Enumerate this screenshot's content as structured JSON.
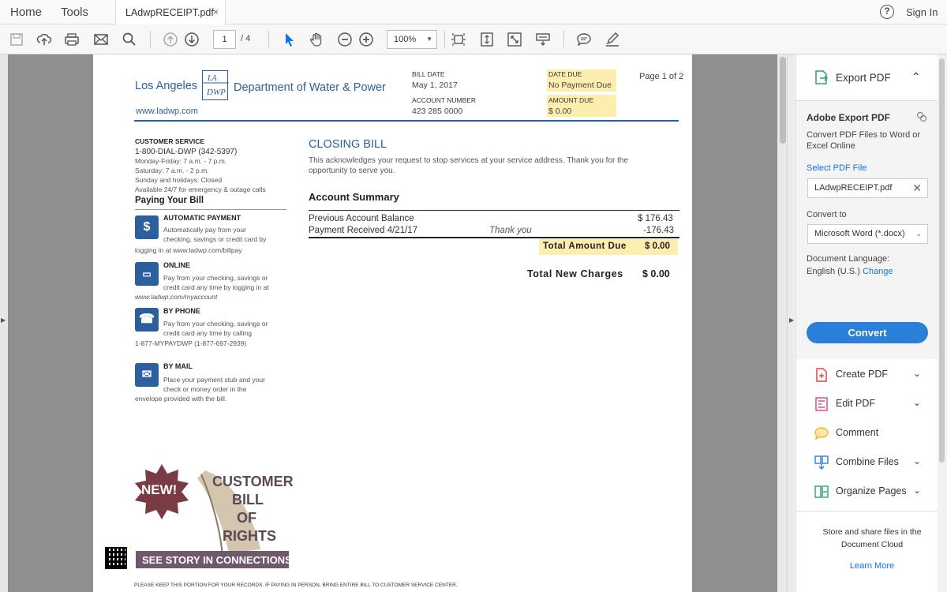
{
  "menu": {
    "home": "Home",
    "tools": "Tools"
  },
  "tab": {
    "title": "LAdwpRECEIPT.pdf",
    "close": "×"
  },
  "header": {
    "help": "?",
    "sign_in": "Sign In"
  },
  "toolbar": {
    "icons": [
      "save-icon",
      "upload-icon",
      "print-icon",
      "email-icon",
      "search-icon",
      "page-up-icon",
      "page-down-icon",
      "select-arrow-icon",
      "hand-tool-icon",
      "zoom-out-icon",
      "zoom-in-icon",
      "fit-page-icon",
      "scroll-mode-icon",
      "full-screen-icon",
      "read-mode-icon",
      "comment-icon",
      "sign-icon"
    ],
    "page_current": "1",
    "page_total": "/ 4",
    "zoom": "100%"
  },
  "bill": {
    "org_left": "Los Angeles",
    "org_right": "Department of Water & Power",
    "logo_text": "LA DWP",
    "website": "www.ladwp.com",
    "bill_date_label": "BILL DATE",
    "bill_date": "May 1, 2017",
    "account_number_label": "ACCOUNT NUMBER",
    "account_number": "423 285 0000",
    "date_due_label": "DATE DUE",
    "date_due": "No Payment Due",
    "amount_due_label": "AMOUNT DUE",
    "amount_due": "$ 0.00",
    "page_of": "Page 1 of 2",
    "customer_service": {
      "title": "CUSTOMER SERVICE",
      "phone": "1-800-DIAL-DWP (342-5397)",
      "hours1": "Monday-Friday: 7 a.m. - 7 p.m.",
      "hours2": "Saturday: 7 a.m. - 2 p.m.",
      "hours3": "Sunday and holidays: Closed",
      "hours4": "Available 24/7 for emergency & outage calls"
    },
    "paying_title": "Paying Your Bill",
    "payment_methods": [
      {
        "title": "AUTOMATIC PAYMENT",
        "line1": "Automatically pay from your",
        "line2": "checking, savings or credit card by",
        "line3": "logging in at www.ladwp.com/billpay"
      },
      {
        "title": "ONLINE",
        "line1": "Pay from your checking, savings or",
        "line2": "credit card any time by logging in at",
        "line3": "www.ladwp.com/myaccount"
      },
      {
        "title": "BY PHONE",
        "line1": "Pay from your checking, savings or",
        "line2": "credit card any time by calling",
        "line3": "1-877-MYPAYDWP (1-877-697-2939)"
      },
      {
        "title": "BY MAIL",
        "line1": "Place your payment stub and your",
        "line2": "check or money order in the",
        "line3": "envelope provided with the bill."
      }
    ],
    "closing_title": "CLOSING BILL",
    "closing_text1": "This acknowledges your request to stop services at your service address. Thank you for the",
    "closing_text2": "opportunity to serve you.",
    "summary_title": "Account Summary",
    "prev_balance_label": "Previous Account Balance",
    "prev_balance": "$ 176.43",
    "payment_label": "Payment Received 4/21/17",
    "payment_note": "Thank you",
    "payment_amount": "-176.43",
    "total_due_label": "Total Amount Due",
    "total_due": "$ 0.00",
    "total_new_label": "Total New Charges",
    "total_new": "$ 0.00",
    "badge_new": "NEW!",
    "badge_line1": "CUSTOMER",
    "badge_line2": "BILL",
    "badge_line3": "OF",
    "badge_line4": "RIGHTS",
    "badge_banner": "SEE STORY IN CONNECTIONS",
    "footer_note": "PLEASE KEEP THIS PORTION FOR YOUR RECORDS. IF PAYING IN PERSON, BRING ENTIRE BILL TO CUSTOMER SERVICE CENTER."
  },
  "right_panel": {
    "export_label": "Export PDF",
    "adobe_export_title": "Adobe Export PDF",
    "description": "Convert PDF Files to Word or Excel Online",
    "select_pdf": "Select PDF File",
    "file_name": "LAdwpRECEIPT.pdf",
    "convert_to_label": "Convert to",
    "convert_to_value": "Microsoft Word (*.docx)",
    "doc_lang_label": "Document Language:",
    "doc_lang_value": "English (U.S.)",
    "change_link": "Change",
    "convert_button": "Convert",
    "tools": [
      {
        "label": "Create PDF",
        "icon": "create-pdf-icon",
        "color": "#e0474c"
      },
      {
        "label": "Edit PDF",
        "icon": "edit-pdf-icon",
        "color": "#e04c8c"
      },
      {
        "label": "Comment",
        "icon": "comment-tool-icon",
        "color": "#f2b630"
      },
      {
        "label": "Combine Files",
        "icon": "combine-files-icon",
        "color": "#2a80d8"
      },
      {
        "label": "Organize Pages",
        "icon": "organize-pages-icon",
        "color": "#2aa07a"
      }
    ],
    "footer_text": "Store and share files in the Document Cloud",
    "learn_more": "Learn More"
  }
}
